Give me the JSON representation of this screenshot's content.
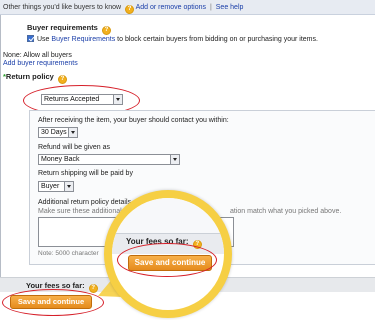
{
  "topbar": {
    "text": "Other things you'd like buyers to know",
    "link1": "Add or remove options",
    "sep": "|",
    "link2": "See help"
  },
  "buyer_requirements": {
    "title": "Buyer requirements",
    "checkbox_use": "Use",
    "checkbox_link": "Buyer Requirements",
    "checkbox_rest": "to block certain buyers from bidding on or purchasing your items.",
    "none_text": "None: Allow all buyers",
    "add_link": "Add buyer requirements"
  },
  "return_policy": {
    "required_mark": "*",
    "title": "Return policy",
    "returns_select": "Returns Accepted",
    "contact_label": "After receiving the item, your buyer should contact you within:",
    "contact_value": "30 Days",
    "refund_label": "Refund will be given as",
    "refund_value": "Money Back",
    "shipping_label": "Return shipping will be paid by",
    "shipping_value": "Buyer",
    "additional_label": "Additional return policy details",
    "additional_hint_left": "Make sure these additional",
    "additional_hint_right": "ation match what you picked above.",
    "note": "Note: 5000 character"
  },
  "fees": {
    "label": "Your fees so far:",
    "button": "Save and continue"
  },
  "magnifier": {
    "label": "Your fees so far:",
    "button": "Save and continue"
  },
  "colors": {
    "accent_orange": "#e58b1d",
    "highlight_red": "#d6202a",
    "magnifier_yellow": "#f6cf44",
    "link_blue": "#1a3ea8"
  }
}
